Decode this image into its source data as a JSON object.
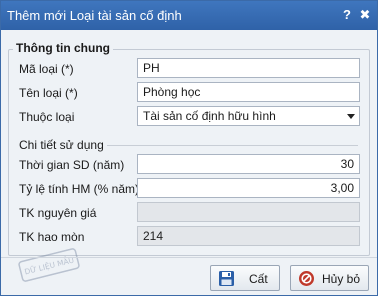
{
  "window": {
    "title": "Thêm mới Loại tài sản cố định",
    "help_glyph": "?",
    "close_glyph": "✖"
  },
  "group": {
    "legend": "Thông tin chung",
    "ma_loai": {
      "label": "Mã loại (*)",
      "value": "PH"
    },
    "ten_loai": {
      "label": "Tên loại (*)",
      "value": "Phòng học"
    },
    "thuoc_loai": {
      "label": "Thuộc loại",
      "value": "Tài sản cố định hữu hình"
    },
    "section_label": "Chi tiết sử dụng",
    "thoi_gian_sd": {
      "label": "Thời gian SD (năm)",
      "value": "30"
    },
    "ty_le_hm": {
      "label": "Tỷ lệ tính HM (% năm)",
      "value": "3,00"
    },
    "tk_nguyen_gia": {
      "label": "TK nguyên giá",
      "value": ""
    },
    "tk_hao_mon": {
      "label": "TK hao mòn",
      "value": "214"
    }
  },
  "footer": {
    "save_label": "Cất",
    "cancel_label": "Hủy bỏ"
  },
  "colors": {
    "titlebar": "#3a6db5",
    "dialog_bg": "#eef2f6",
    "cancel_icon": "#c0392b",
    "save_icon": "#2b5fa8"
  },
  "icons": {
    "save": "floppy-disk-icon",
    "cancel": "cancel-circle-icon",
    "dropdown": "chevron-down-icon",
    "help": "help-icon",
    "close": "close-icon"
  },
  "watermark": "DỮ LIỆU MẪU"
}
